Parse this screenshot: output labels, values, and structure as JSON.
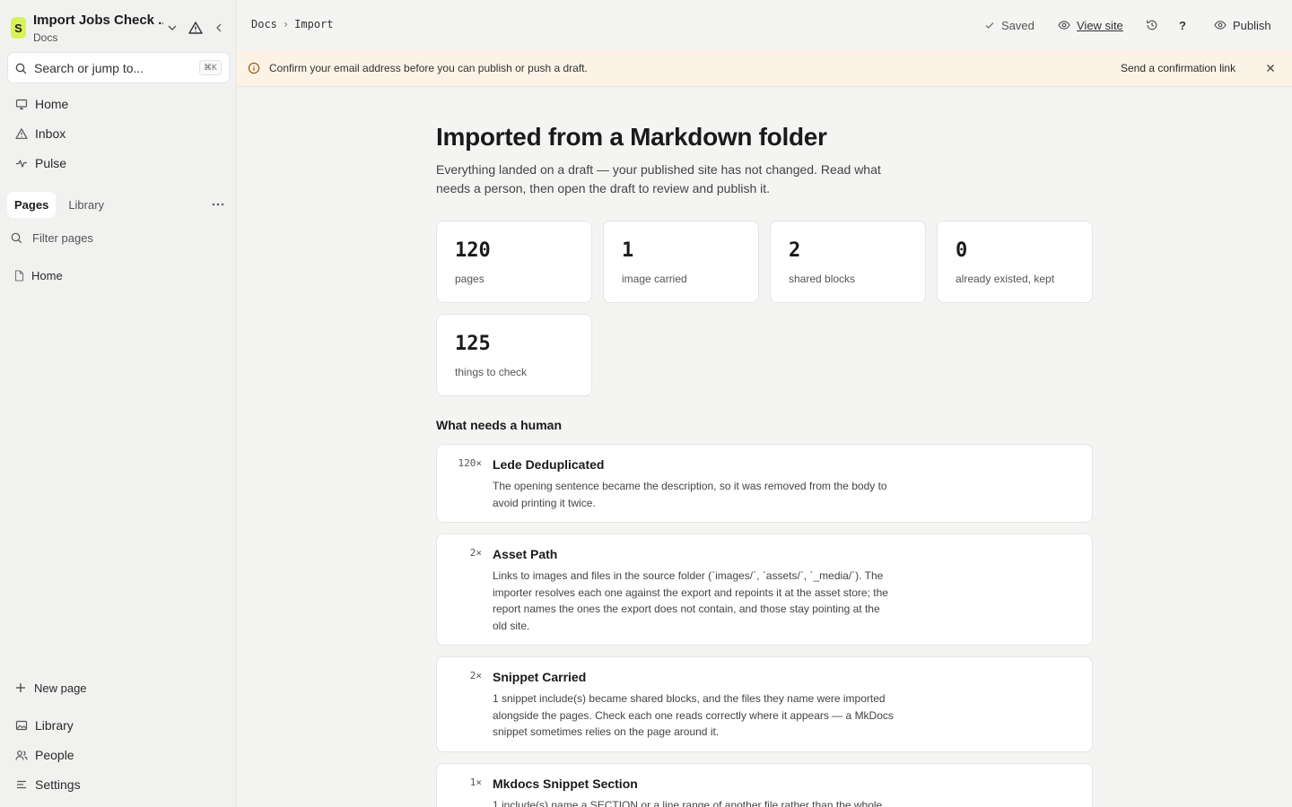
{
  "sidebar": {
    "workspace_title": "Import Jobs Check ...",
    "workspace_sub": "Docs",
    "search_placeholder": "Search or jump to...",
    "search_shortcut": "⌘K",
    "nav": [
      {
        "label": "Home",
        "icon": "monitor-icon"
      },
      {
        "label": "Inbox",
        "icon": "warning-icon"
      },
      {
        "label": "Pulse",
        "icon": "pulse-icon"
      }
    ],
    "tabs": [
      "Pages",
      "Library"
    ],
    "filter_placeholder": "Filter pages",
    "pages": [
      {
        "label": "Home"
      }
    ],
    "new_page": "New page",
    "bottom_nav": [
      {
        "label": "Library",
        "icon": "image-icon"
      },
      {
        "label": "People",
        "icon": "people-icon"
      },
      {
        "label": "Settings",
        "icon": "menu-icon"
      }
    ]
  },
  "topbar": {
    "breadcrumb": [
      "Docs",
      "Import"
    ],
    "saved": "Saved",
    "view_site": "View site",
    "help": "?",
    "publish": "Publish"
  },
  "banner": {
    "message": "Confirm your email address before you can publish or push a draft.",
    "action": "Send a confirmation link"
  },
  "main": {
    "title": "Imported from a Markdown folder",
    "lede": "Everything landed on a draft — your published site has not changed. Read what needs a person, then open the draft to review and publish it.",
    "stats": [
      {
        "value": "120",
        "label": "pages"
      },
      {
        "value": "1",
        "label": "image carried"
      },
      {
        "value": "2",
        "label": "shared blocks"
      },
      {
        "value": "0",
        "label": "already existed, kept"
      },
      {
        "value": "125",
        "label": "things to check"
      }
    ],
    "section_title": "What needs a human",
    "issues": [
      {
        "count": "120×",
        "title": "Lede Deduplicated",
        "desc": "The opening sentence became the description, so it was removed from the body to avoid printing it twice."
      },
      {
        "count": "2×",
        "title": "Asset Path",
        "desc": "Links to images and files in the source folder (`images/`, `assets/`, `_media/`). The importer resolves each one against the export and repoints it at the asset store; the report names the ones the export does not contain, and those stay pointing at the old site."
      },
      {
        "count": "2×",
        "title": "Snippet Carried",
        "desc": "1 snippet include(s) became shared blocks, and the files they name were imported alongside the pages. Check each one reads correctly where it appears — a MkDocs snippet sometimes relies on the page around it."
      },
      {
        "count": "1×",
        "title": "Mkdocs Snippet Section",
        "desc": "1 include(s) name a SECTION or a line range of another file rather than the whole"
      }
    ]
  }
}
